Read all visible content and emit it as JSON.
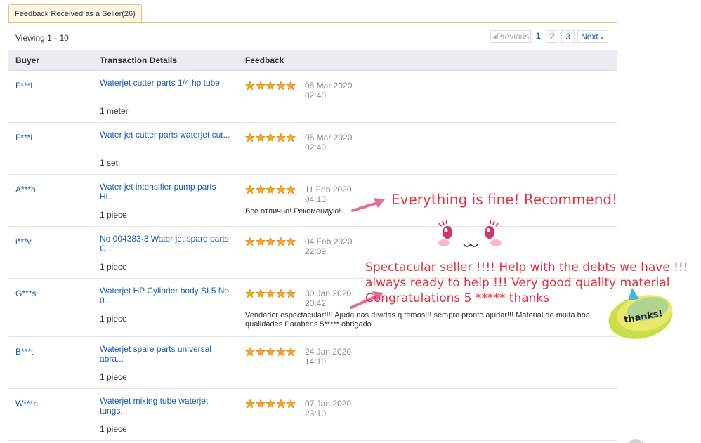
{
  "tab": {
    "label": "Feedback Received as a Seller(26)"
  },
  "viewing": "Viewing 1 - 10",
  "pager": {
    "previous": "Previous",
    "pages": [
      "1",
      "2",
      "3"
    ],
    "next": "Next"
  },
  "columns": {
    "buyer": "Buyer",
    "transaction": "Transaction Details",
    "feedback": "Feedback"
  },
  "rows": [
    {
      "buyer": "F***l",
      "item": "Waterjet cutter parts 1/4 hp tube",
      "qty": "1 meter",
      "rating": 5,
      "date": "05 Mar 2020",
      "time": "02:40",
      "comment": ""
    },
    {
      "buyer": "F***l",
      "item": "Water jet cutter parts waterjet cut...",
      "qty": "1 set",
      "rating": 5,
      "date": "05 Mar 2020",
      "time": "02:40",
      "comment": ""
    },
    {
      "buyer": "A***h",
      "item": "Water jet intensifier pump parts Hi...",
      "qty": "1 piece",
      "rating": 5,
      "date": "11 Feb 2020",
      "time": "04:13",
      "comment": "Все отлично! Рекомендую!"
    },
    {
      "buyer": "i***v",
      "item": "No 004383-3 Water jet spare parts C...",
      "qty": "1 piece",
      "rating": 5,
      "date": "04 Feb 2020",
      "time": "22:09",
      "comment": ""
    },
    {
      "buyer": "G***s",
      "item": "Waterjet HP Cylinder body SL5 No. 0...",
      "qty": "1 piece",
      "rating": 5,
      "date": "30 Jan 2020",
      "time": "20:42",
      "comment": "Vendedor espectacular!!!! Ajuda nas dívidas q temos!!! sempre pronto ajudar!!! Material de muita boa qualidades Parabéns 5***** obrigado"
    },
    {
      "buyer": "B***t",
      "item": "Waterjet spare parts universal abra...",
      "qty": "1 piece",
      "rating": 5,
      "date": "24 Jan 2020",
      "time": "14:10",
      "comment": ""
    },
    {
      "buyer": "W***n",
      "item": "Waterjet mixing tube waterjet tungs...",
      "qty": "1 piece",
      "rating": 5,
      "date": "07 Jan 2020",
      "time": "23:10",
      "comment": ""
    }
  ],
  "annotations": {
    "translation_1": "Everything is fine! Recommend!",
    "translation_2_line1": "Spectacular seller !!!! Help with the debts we have !!!",
    "translation_2_line2": "always ready to help !!! Very good quality material",
    "translation_2_line3": "Congratulations 5 ***** thanks",
    "bubble_text": "thanks!"
  },
  "colors": {
    "link": "#1a5cb0",
    "star": "#f5a623",
    "annotation": "#e4303f",
    "arrow": "#e56a9a",
    "tab_border": "#e4c27a"
  }
}
